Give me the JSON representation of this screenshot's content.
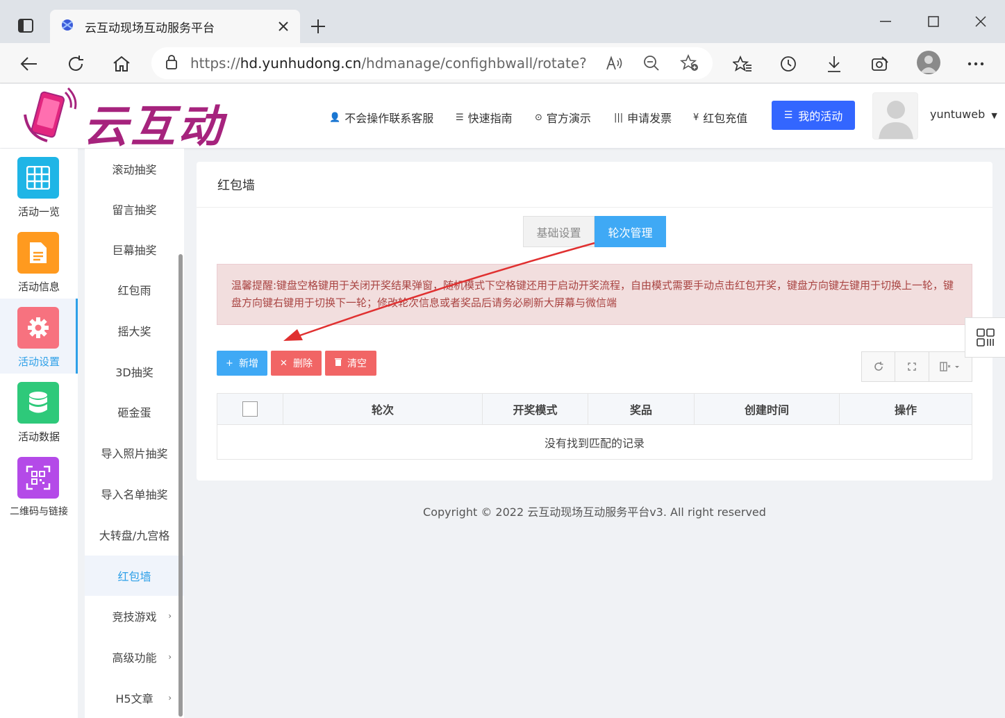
{
  "browser": {
    "tab_title": "云互动现场互动服务平台",
    "url_prefix": "https://",
    "url_host": "hd.yunhudong.cn",
    "url_path": "/hdmanage/confighbwall/rotate?h..."
  },
  "header": {
    "logo_text": "云互动",
    "nav": [
      {
        "label": "不会操作联系客服",
        "icon": "user-plus-icon"
      },
      {
        "label": "快速指南",
        "icon": "list-icon"
      },
      {
        "label": "官方演示",
        "icon": "play-circle-icon"
      },
      {
        "label": "申请发票",
        "icon": "barcode-icon"
      },
      {
        "label": "红包充值",
        "icon": "yen-icon"
      }
    ],
    "my_activity": "我的活动",
    "username": "yuntuweb"
  },
  "left_bar": [
    {
      "label": "活动一览",
      "color": "#1fb5e6",
      "icon": "grid-icon"
    },
    {
      "label": "活动信息",
      "color": "#ff9a1f",
      "icon": "document-icon"
    },
    {
      "label": "活动设置",
      "color": "#f7727f",
      "icon": "gear-icon",
      "active": true
    },
    {
      "label": "活动数据",
      "color": "#2ec97a",
      "icon": "database-icon"
    },
    {
      "label": "二维码与链接",
      "color": "#b44ae8",
      "icon": "qrcode-icon"
    }
  ],
  "sub_menu": [
    {
      "label": "滚动抽奖"
    },
    {
      "label": "留言抽奖"
    },
    {
      "label": "巨幕抽奖"
    },
    {
      "label": "红包雨"
    },
    {
      "label": "摇大奖"
    },
    {
      "label": "3D抽奖"
    },
    {
      "label": "砸金蛋"
    },
    {
      "label": "导入照片抽奖"
    },
    {
      "label": "导入名单抽奖"
    },
    {
      "label": "大转盘/九宫格"
    },
    {
      "label": "红包墙",
      "active": true
    },
    {
      "label": "竞技游戏",
      "arrow": "›"
    },
    {
      "label": "高级功能",
      "arrow": "›"
    },
    {
      "label": "H5文章",
      "arrow": "›"
    }
  ],
  "panel": {
    "title": "红包墙",
    "tabs": [
      "基础设置",
      "轮次管理"
    ],
    "alert": "温馨提醒:键盘空格键用于关闭开奖结果弹窗，随机模式下空格键还用于启动开奖流程，自由模式需要手动点击红包开奖，键盘方向键左键用于切换上一轮，键盘方向键右键用于切换下一轮；修改轮次信息或者奖品后请务必刷新大屏幕与微信端",
    "buttons": {
      "add": "新增",
      "delete": "删除",
      "clear": "清空"
    },
    "table": {
      "headers": [
        "轮次",
        "开奖模式",
        "奖品",
        "创建时间",
        "操作"
      ],
      "empty": "没有找到匹配的记录"
    }
  },
  "footer": "Copyright © 2022 云互动现场互动服务平台v3. All right reserved",
  "colors": {
    "primary": "#3fa9f5",
    "danger": "#f16565",
    "accent": "#3366ff",
    "alert_bg": "#f2dede",
    "annotation_arrow": "#e03030"
  }
}
